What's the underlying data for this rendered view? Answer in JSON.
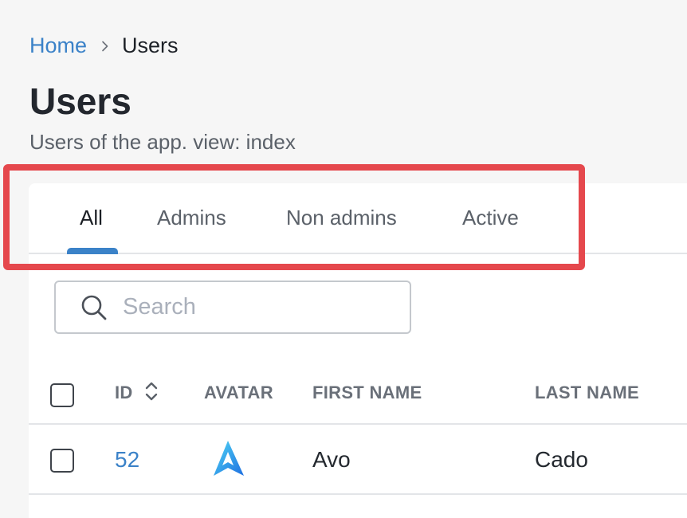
{
  "breadcrumb": {
    "home": "Home",
    "current": "Users"
  },
  "page": {
    "title": "Users",
    "description": "Users of the app. view: index"
  },
  "tabs": [
    {
      "label": "All",
      "active": true
    },
    {
      "label": "Admins",
      "active": false
    },
    {
      "label": "Non admins",
      "active": false
    },
    {
      "label": "Active",
      "active": false
    }
  ],
  "search": {
    "placeholder": "Search",
    "value": ""
  },
  "table": {
    "columns": [
      "ID",
      "AVATAR",
      "FIRST NAME",
      "LAST NAME"
    ],
    "rows": [
      {
        "id": "52",
        "avatar": "avo-logo-icon",
        "first_name": "Avo",
        "last_name": "Cado"
      }
    ]
  },
  "icons": {
    "breadcrumb_separator": "chevron-right-icon",
    "search": "search-icon",
    "sort": "sort-icon"
  },
  "colors": {
    "link": "#3b82c8",
    "active_tab_indicator": "#3b82c8",
    "highlight": "#e5484d"
  }
}
